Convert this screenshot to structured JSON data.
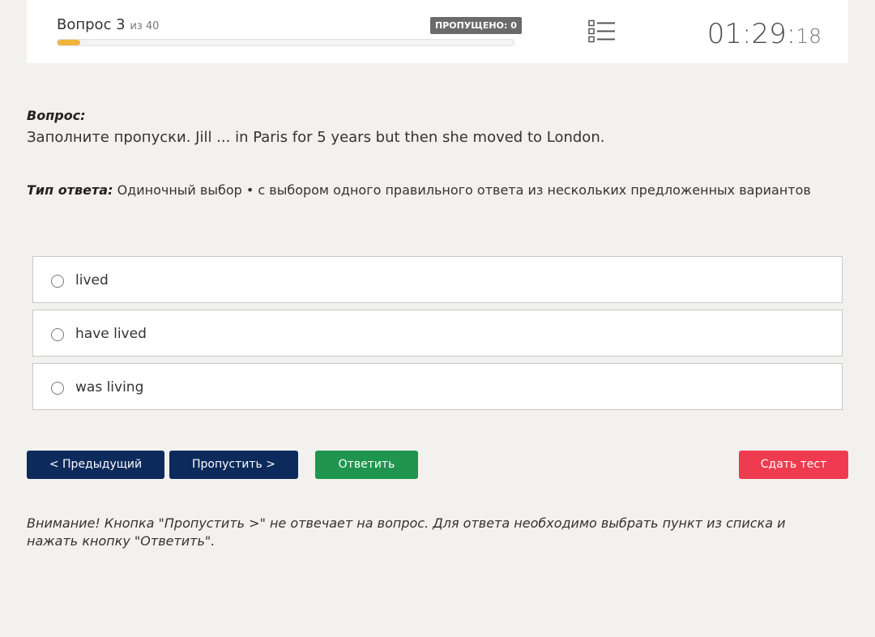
{
  "header": {
    "question_label": "Вопрос 3",
    "question_of": "из 40",
    "skipped_badge": "ПРОПУЩЕНО: 0",
    "progress_fraction": 0.05,
    "timer_main": "01:29:",
    "timer_seconds": "18",
    "list_icon": "list-icon"
  },
  "question": {
    "label": "Вопрос:",
    "text": "Заполните пропуски. Jill ... in Paris for 5 years but then she moved to London."
  },
  "answer_type": {
    "label": "Тип ответа:",
    "value": "Одиночный выбор • с выбором одного правильного ответа из нескольких предложенных вариантов"
  },
  "options": [
    {
      "label": "lived"
    },
    {
      "label": "have lived"
    },
    {
      "label": "was living"
    }
  ],
  "buttons": {
    "prev": "< Предыдущий",
    "skip": "Пропустить >",
    "answer": "Ответить",
    "submit": "Сдать тест"
  },
  "notice": "Внимание! Кнопка \"Пропустить >\" не отвечает на вопрос. Для ответа необходимо выбрать пункт из списка и нажать кнопку \"Ответить\".",
  "colors": {
    "nav_button": "#0d2a5c",
    "answer_button": "#20954f",
    "submit_button": "#ef3b4f",
    "progress_fill": "#f0b43c"
  }
}
